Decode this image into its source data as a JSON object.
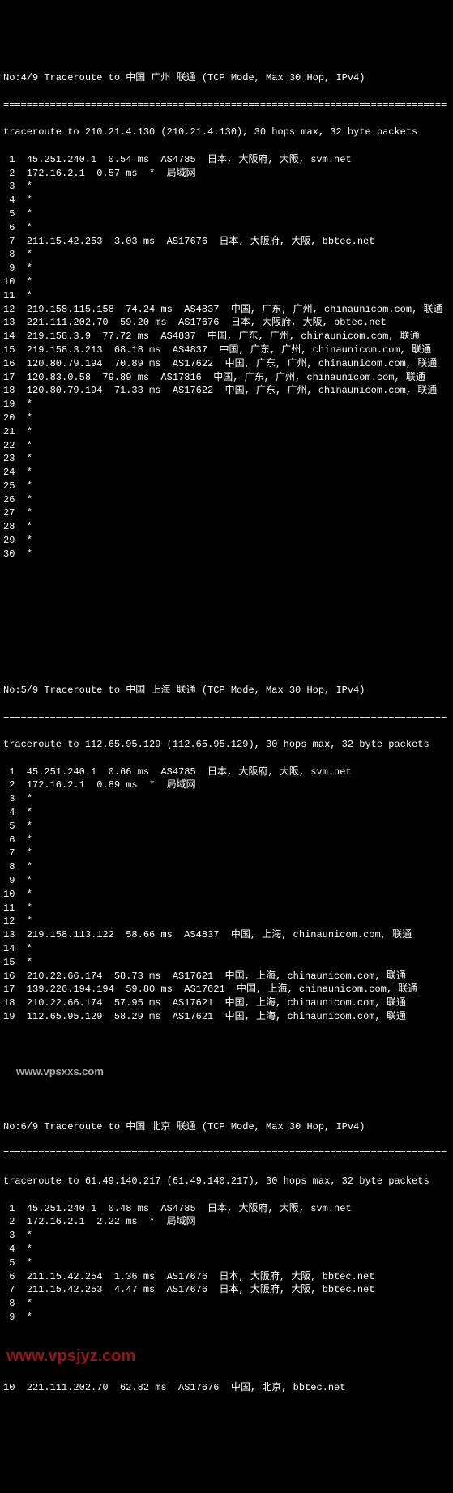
{
  "block4": {
    "header": "No:4/9 Traceroute to 中国 广州 联通 (TCP Mode, Max 30 Hop, IPv4)",
    "divider": "============================================================================",
    "summary": "traceroute to 210.21.4.130 (210.21.4.130), 30 hops max, 32 byte packets",
    "hops": [
      " 1  45.251.240.1  0.54 ms  AS4785  日本, 大阪府, 大阪, svm.net",
      " 2  172.16.2.1  0.57 ms  *  局域网",
      " 3  *",
      " 4  *",
      " 5  *",
      " 6  *",
      " 7  211.15.42.253  3.03 ms  AS17676  日本, 大阪府, 大阪, bbtec.net",
      " 8  *",
      " 9  *",
      "10  *",
      "11  *",
      "12  219.158.115.158  74.24 ms  AS4837  中国, 广东, 广州, chinaunicom.com, 联通",
      "13  221.111.202.70  59.20 ms  AS17676  日本, 大阪府, 大阪, bbtec.net",
      "14  219.158.3.9  77.72 ms  AS4837  中国, 广东, 广州, chinaunicom.com, 联通",
      "15  219.158.3.213  68.18 ms  AS4837  中国, 广东, 广州, chinaunicom.com, 联通",
      "16  120.80.79.194  70.89 ms  AS17622  中国, 广东, 广州, chinaunicom.com, 联通",
      "17  120.83.0.58  79.89 ms  AS17816  中国, 广东, 广州, chinaunicom.com, 联通",
      "18  120.80.79.194  71.33 ms  AS17622  中国, 广东, 广州, chinaunicom.com, 联通",
      "19  *",
      "20  *",
      "21  *",
      "22  *",
      "23  *",
      "24  *",
      "25  *",
      "26  *",
      "27  *",
      "28  *",
      "29  *",
      "30  *"
    ]
  },
  "block5": {
    "header": "No:5/9 Traceroute to 中国 上海 联通 (TCP Mode, Max 30 Hop, IPv4)",
    "divider": "============================================================================",
    "summary": "traceroute to 112.65.95.129 (112.65.95.129), 30 hops max, 32 byte packets",
    "hops": [
      " 1  45.251.240.1  0.66 ms  AS4785  日本, 大阪府, 大阪, svm.net",
      " 2  172.16.2.1  0.89 ms  *  局域网",
      " 3  *",
      " 4  *",
      " 5  *",
      " 6  *",
      " 7  *",
      " 8  *",
      " 9  *",
      "10  *",
      "11  *",
      "12  *",
      "13  219.158.113.122  58.66 ms  AS4837  中国, 上海, chinaunicom.com, 联通",
      "14  *",
      "15  *",
      "16  210.22.66.174  58.73 ms  AS17621  中国, 上海, chinaunicom.com, 联通",
      "17  139.226.194.194  59.80 ms  AS17621  中国, 上海, chinaunicom.com, 联通",
      "18  210.22.66.174  57.95 ms  AS17621  中国, 上海, chinaunicom.com, 联通",
      "19  112.65.95.129  58.29 ms  AS17621  中国, 上海, chinaunicom.com, 联通"
    ]
  },
  "watermark1": "www.vpsxxs.com",
  "block6": {
    "header": "No:6/9 Traceroute to 中国 北京 联通 (TCP Mode, Max 30 Hop, IPv4)",
    "divider": "============================================================================",
    "summary": "traceroute to 61.49.140.217 (61.49.140.217), 30 hops max, 32 byte packets",
    "hops": [
      " 1  45.251.240.1  0.48 ms  AS4785  日本, 大阪府, 大阪, svm.net",
      " 2  172.16.2.1  2.22 ms  *  局域网",
      " 3  *",
      " 4  *",
      " 5  *",
      " 6  211.15.42.254  1.36 ms  AS17676  日本, 大阪府, 大阪, bbtec.net",
      " 7  211.15.42.253  4.47 ms  AS17676  日本, 大阪府, 大阪, bbtec.net",
      " 8  *",
      " 9  *",
      "10  221.111.202.70  62.82 ms  AS17676  中国, 北京, bbtec.net"
    ]
  },
  "watermark2": "www.vpsjyz.com"
}
